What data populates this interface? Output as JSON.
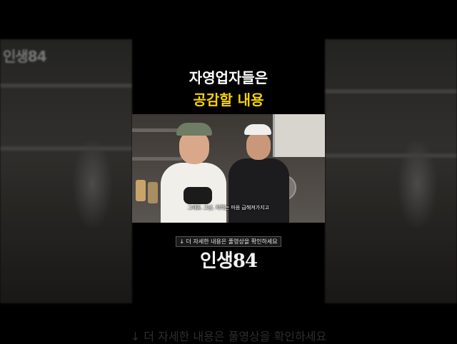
{
  "caption": {
    "line1": "자영업자들은",
    "line2": "공감할 내용",
    "line2_color": "#f5d300"
  },
  "video": {
    "subtitle": "그래도 그냥, 저희는 마음 급해져가지고"
  },
  "info_bar": {
    "text": "↓ 더 자세한 내용은 풀영상을 확인하세요"
  },
  "channel": {
    "logo": "인생84",
    "watermark": "인생84"
  },
  "colors": {
    "background": "#000000",
    "caption_white": "#ffffff",
    "caption_yellow": "#f5d300"
  }
}
